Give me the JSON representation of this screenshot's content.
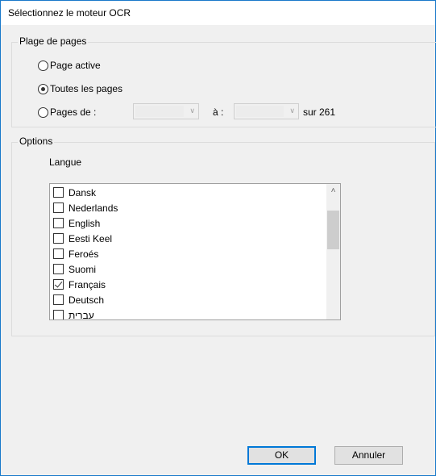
{
  "window": {
    "title": "Sélectionnez le moteur OCR",
    "accent_color": "#1979ca"
  },
  "page_range": {
    "legend": "Plage de pages",
    "options": [
      {
        "label": "Page active",
        "checked": false
      },
      {
        "label": "Toutes les pages",
        "checked": true
      },
      {
        "label": "Pages de :",
        "checked": false
      }
    ],
    "from_value": "",
    "to_label": "à :",
    "to_value": "",
    "total_label": "sur 261"
  },
  "options": {
    "legend": "Options",
    "language_label": "Langue",
    "languages": [
      {
        "label": "Dansk",
        "checked": false
      },
      {
        "label": "Nederlands",
        "checked": false
      },
      {
        "label": "English",
        "checked": false
      },
      {
        "label": "Eesti Keel",
        "checked": false
      },
      {
        "label": "Feroés",
        "checked": false
      },
      {
        "label": "Suomi",
        "checked": false
      },
      {
        "label": "Français",
        "checked": true
      },
      {
        "label": "Deutsch",
        "checked": false
      },
      {
        "label": "עברית",
        "checked": false
      }
    ]
  },
  "buttons": {
    "ok": "OK",
    "cancel": "Annuler"
  }
}
